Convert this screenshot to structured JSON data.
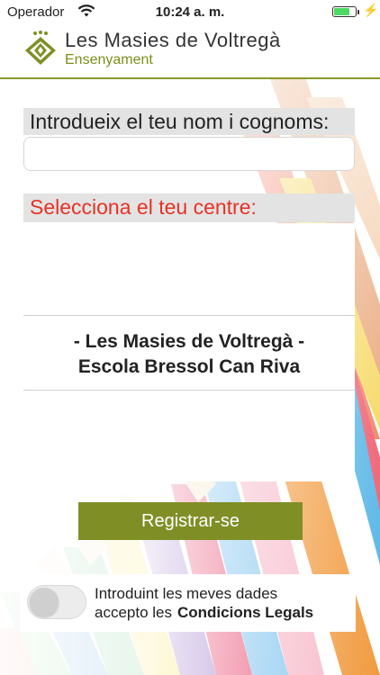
{
  "status_bar": {
    "carrier": "Operador",
    "time": "10:24 a. m.",
    "battery_level": 0.75
  },
  "header": {
    "brand": "Les Masies de Voltregà",
    "subtitle": "Ensenyament"
  },
  "form": {
    "name_label": "Introdueix el teu nom i cognoms:",
    "name_value": "",
    "centre_label": "Selecciona el teu centre:",
    "selected_centre_line1": "- Les Masies de Voltregà -",
    "selected_centre_line2": "Escola Bressol Can Riva",
    "register_label": "Registrar-se"
  },
  "legal": {
    "toggle_on": false,
    "text_line1": "Introduint les meves dades",
    "text_line2": "accepto les",
    "link_label": "Condicions Legals"
  },
  "colors": {
    "accent": "#7f8f26",
    "label_red": "#e53225"
  }
}
